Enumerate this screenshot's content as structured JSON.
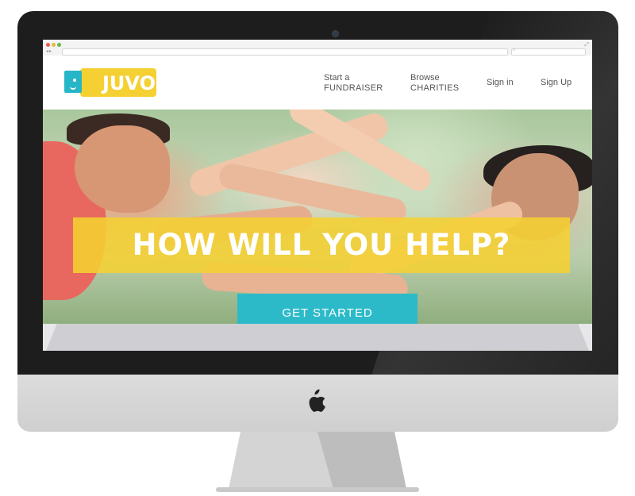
{
  "site": {
    "logo_text": "JUVO",
    "nav": {
      "start_line1": "Start a",
      "start_line2": "FUNDRAISER",
      "browse_line1": "Browse",
      "browse_line2": "CHARITIES",
      "signin": "Sign in",
      "signup": "Sign Up"
    }
  },
  "hero": {
    "headline": "HOW WILL YOU HELP?",
    "cta": "GET STARTED"
  },
  "colors": {
    "brand_yellow": "#f5d032",
    "brand_teal": "#2cbac9",
    "nav_text": "#555555"
  },
  "icons": {
    "logo_mark": "smiley-face-icon",
    "monitor_logo": "apple-icon"
  }
}
